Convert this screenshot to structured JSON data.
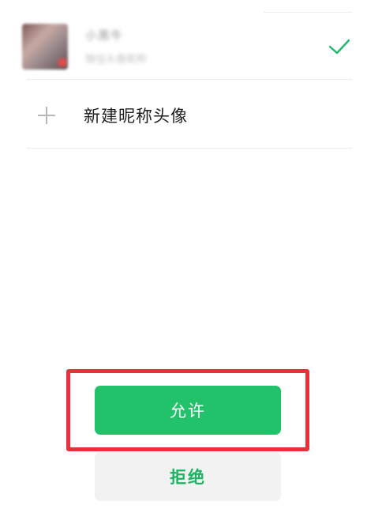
{
  "accounts": [
    {
      "nickname": "小黑牛",
      "subtitle": "微信头像昵称",
      "selected": true
    }
  ],
  "new_profile": {
    "label": "新建昵称头像",
    "icon": "plus-icon"
  },
  "selection_icon": "check-icon",
  "buttons": {
    "allow_label": "允许",
    "reject_label": "拒绝"
  },
  "colors": {
    "primary_green": "#21c26a",
    "reject_text_green": "#1eb463",
    "check_green": "#21b768",
    "highlight_red": "#e8313a",
    "reject_bg": "#f2f2f2"
  }
}
